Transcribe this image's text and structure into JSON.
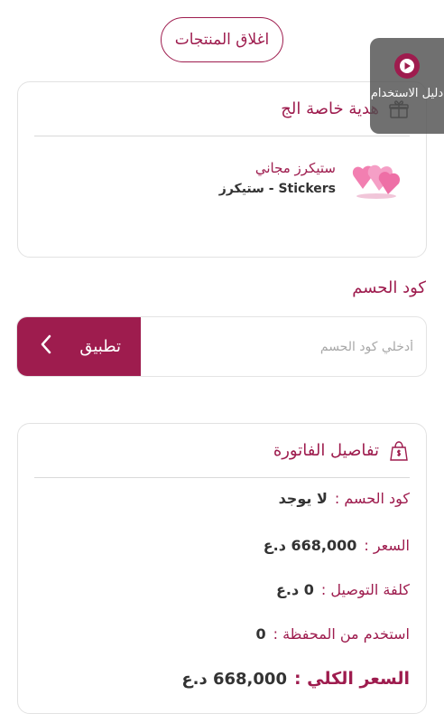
{
  "header": {
    "close_products_label": "اغلاق المنتجات"
  },
  "gift": {
    "title": "هدية خاصة الج",
    "item_name": "ستيكرز مجاني",
    "item_subtitle": "Stickers - ستيكرز"
  },
  "discount": {
    "label": "كود الحسم",
    "placeholder": "أدخلي كود الحسم",
    "apply_label": "تطبيق"
  },
  "invoice": {
    "title": "تفاصيل الفاتورة",
    "rows": [
      {
        "label": "كود الحسم :",
        "value": "لا يوجد"
      },
      {
        "label": "السعر :",
        "value": "668,000 د.ع"
      },
      {
        "label": "كلفة التوصيل :",
        "value": "0 د.ع"
      },
      {
        "label": "استخدم من المحفظة :",
        "value": "0"
      }
    ],
    "total_label": "السعر الكلي :",
    "total_value": "668,000 د.ع"
  },
  "guide": {
    "label": "دليل الاستخدام"
  },
  "colors": {
    "accent": "#9e1c4e",
    "guide_bg": "#505050"
  }
}
